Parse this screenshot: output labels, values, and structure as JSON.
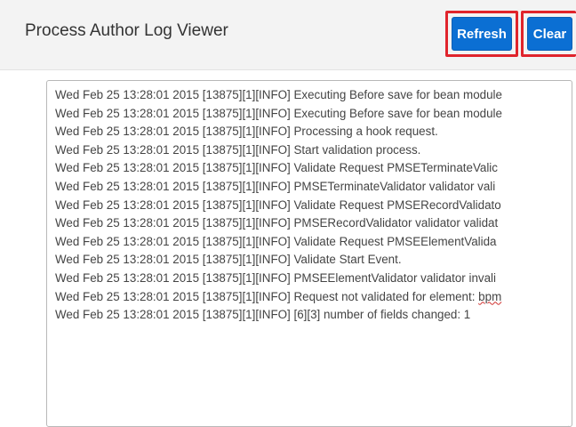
{
  "header": {
    "title": "Process Author Log Viewer",
    "refresh_label": "Refresh",
    "clear_label": "Clear"
  },
  "log": {
    "lines": [
      "Wed Feb 25 13:28:01 2015 [13875][1][INFO] Executing Before save for bean module",
      "Wed Feb 25 13:28:01 2015 [13875][1][INFO] Executing Before save for bean module",
      "Wed Feb 25 13:28:01 2015 [13875][1][INFO] Processing a hook request.",
      "Wed Feb 25 13:28:01 2015 [13875][1][INFO] Start validation process.",
      "Wed Feb 25 13:28:01 2015 [13875][1][INFO] Validate Request PMSETerminateValic",
      "Wed Feb 25 13:28:01 2015 [13875][1][INFO] PMSETerminateValidator validator vali",
      "Wed Feb 25 13:28:01 2015 [13875][1][INFO] Validate Request PMSERecordValidato",
      "Wed Feb 25 13:28:01 2015 [13875][1][INFO] PMSERecordValidator validator validat",
      "Wed Feb 25 13:28:01 2015 [13875][1][INFO] Validate Request PMSEElementValida",
      "Wed Feb 25 13:28:01 2015 [13875][1][INFO] Validate Start Event.",
      "Wed Feb 25 13:28:01 2015 [13875][1][INFO] PMSEElementValidator validator invali",
      "Wed Feb 25 13:28:01 2015 [13875][1][INFO] Request not validated for element: ",
      "Wed Feb 25 13:28:01 2015 [13875][1][INFO] [6][3] number of fields changed: 1"
    ],
    "line12_suffix": "bpm"
  },
  "colors": {
    "header_bg": "#f3f3f3",
    "button_bg": "#0b6fd3",
    "highlight_border": "#e0242c"
  }
}
